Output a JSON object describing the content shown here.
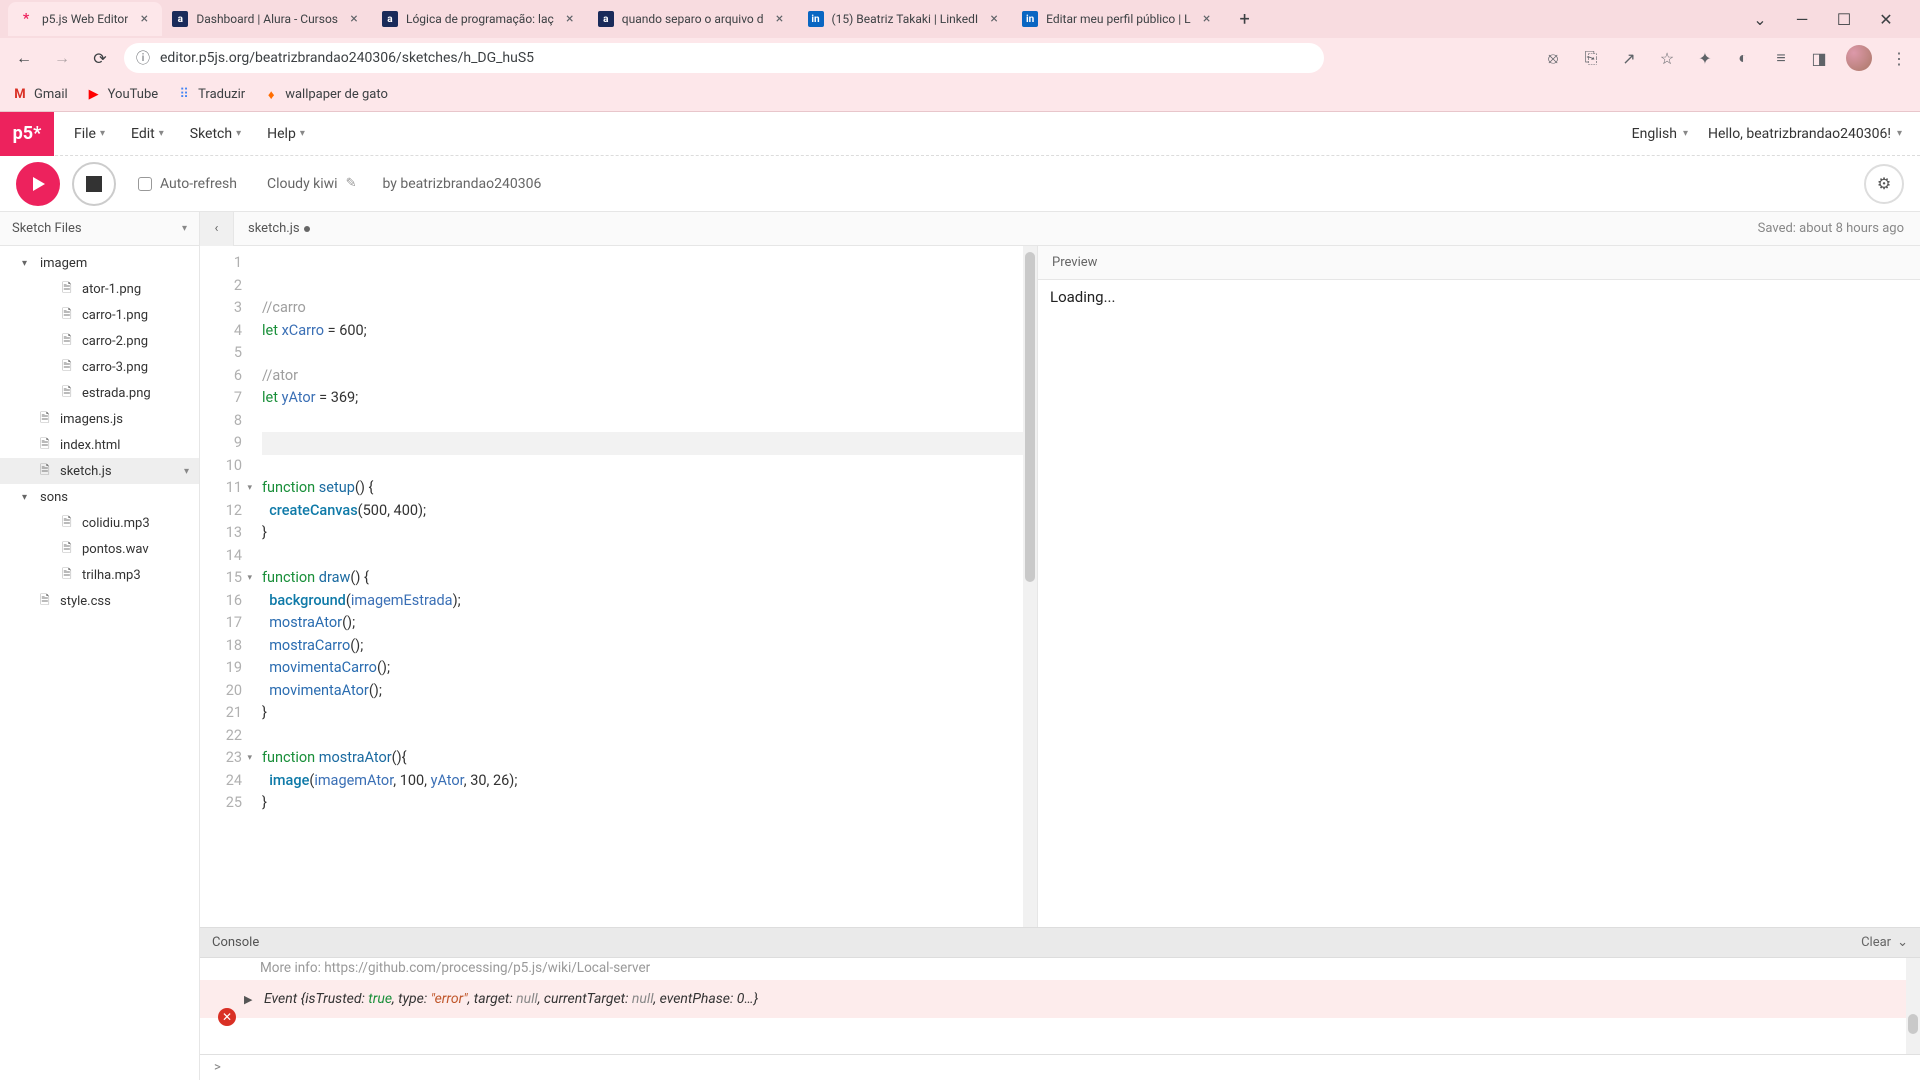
{
  "browser": {
    "tabs": [
      {
        "title": "p5.js Web Editor",
        "favicon": "p5",
        "active": true
      },
      {
        "title": "Dashboard | Alura - Cursos",
        "favicon": "alura"
      },
      {
        "title": "Lógica de programação: laç",
        "favicon": "alura"
      },
      {
        "title": "quando separo o arquivo d",
        "favicon": "alura"
      },
      {
        "title": "(15) Beatriz Takaki | LinkedI",
        "favicon": "linkedin"
      },
      {
        "title": "Editar meu perfil público | L",
        "favicon": "linkedin"
      }
    ],
    "url": "editor.p5js.org/beatrizbrandao240306/sketches/h_DG_huS5",
    "bookmarks": [
      {
        "label": "Gmail",
        "icon": "gmail"
      },
      {
        "label": "YouTube",
        "icon": "youtube"
      },
      {
        "label": "Traduzir",
        "icon": "translate"
      },
      {
        "label": "wallpaper de gato",
        "icon": "fire"
      }
    ]
  },
  "menubar": {
    "logo": "p5*",
    "menus": [
      "File",
      "Edit",
      "Sketch",
      "Help"
    ],
    "language": "English",
    "greeting": "Hello, beatrizbrandao240306!"
  },
  "toolbar": {
    "autorefresh_label": "Auto-refresh",
    "project_name": "Cloudy kiwi",
    "byline_prefix": "by ",
    "byline_user": "beatrizbrandao240306"
  },
  "sidebar": {
    "header": "Sketch Files",
    "tree": [
      {
        "type": "folder",
        "name": "imagem",
        "depth": 1,
        "open": true
      },
      {
        "type": "file",
        "name": "ator-1.png",
        "depth": 2
      },
      {
        "type": "file",
        "name": "carro-1.png",
        "depth": 2
      },
      {
        "type": "file",
        "name": "carro-2.png",
        "depth": 2
      },
      {
        "type": "file",
        "name": "carro-3.png",
        "depth": 2
      },
      {
        "type": "file",
        "name": "estrada.png",
        "depth": 2
      },
      {
        "type": "file",
        "name": "imagens.js",
        "depth": 1
      },
      {
        "type": "file",
        "name": "index.html",
        "depth": 1
      },
      {
        "type": "file",
        "name": "sketch.js",
        "depth": 1,
        "selected": true,
        "opts": true
      },
      {
        "type": "folder",
        "name": "sons",
        "depth": 1,
        "open": true
      },
      {
        "type": "file",
        "name": "colidiu.mp3",
        "depth": 2
      },
      {
        "type": "file",
        "name": "pontos.wav",
        "depth": 2
      },
      {
        "type": "file",
        "name": "trilha.mp3",
        "depth": 2
      },
      {
        "type": "file",
        "name": "style.css",
        "depth": 1
      }
    ]
  },
  "editor": {
    "tab_name": "sketch.js",
    "dirty": true,
    "saved_text": "Saved: about 8 hours ago",
    "line_count": 25,
    "fold_lines": [
      11,
      15,
      23
    ],
    "highlighted_line": 9,
    "lines": [
      {
        "n": 1,
        "html": ""
      },
      {
        "n": 2,
        "html": ""
      },
      {
        "n": 3,
        "html": "<span class='tok-comment'>//carro</span>"
      },
      {
        "n": 4,
        "html": "<span class='tok-kw'>let</span> <span class='tok-var'>xCarro</span> = <span class='tok-num'>600</span>;"
      },
      {
        "n": 5,
        "html": ""
      },
      {
        "n": 6,
        "html": "<span class='tok-comment'>//ator</span>"
      },
      {
        "n": 7,
        "html": "<span class='tok-kw'>let</span> <span class='tok-var'>yAtor</span> = <span class='tok-num'>369</span>;"
      },
      {
        "n": 8,
        "html": ""
      },
      {
        "n": 9,
        "html": ""
      },
      {
        "n": 10,
        "html": ""
      },
      {
        "n": 11,
        "html": "<span class='tok-kw'>function</span> <span class='tok-fn'>setup</span>() {"
      },
      {
        "n": 12,
        "html": "  <span class='tok-builtin'>createCanvas</span>(<span class='tok-num'>500</span>, <span class='tok-num'>400</span>);"
      },
      {
        "n": 13,
        "html": "}"
      },
      {
        "n": 14,
        "html": ""
      },
      {
        "n": 15,
        "html": "<span class='tok-kw'>function</span> <span class='tok-fn'>draw</span>() {"
      },
      {
        "n": 16,
        "html": "  <span class='tok-builtin'>background</span>(<span class='tok-var'>imagemEstrada</span>);"
      },
      {
        "n": 17,
        "html": "  <span class='tok-call'>mostraAtor</span>();"
      },
      {
        "n": 18,
        "html": "  <span class='tok-call'>mostraCarro</span>();"
      },
      {
        "n": 19,
        "html": "  <span class='tok-call'>movimentaCarro</span>();"
      },
      {
        "n": 20,
        "html": "  <span class='tok-call'>movimentaAtor</span>();"
      },
      {
        "n": 21,
        "html": "}"
      },
      {
        "n": 22,
        "html": ""
      },
      {
        "n": 23,
        "html": "<span class='tok-kw'>function</span> <span class='tok-fn'>mostraAtor</span>(){"
      },
      {
        "n": 24,
        "html": "  <span class='tok-builtin'>image</span>(<span class='tok-var'>imagemAtor</span>, <span class='tok-num'>100</span>, <span class='tok-var'>yAtor</span>, <span class='tok-num'>30</span>, <span class='tok-num'>26</span>);"
      },
      {
        "n": 25,
        "html": "}"
      }
    ]
  },
  "preview": {
    "header": "Preview",
    "loading": "Loading..."
  },
  "console": {
    "header": "Console",
    "clear": "Clear",
    "hidden_line": "More info: https://github.com/processing/p5.js/wiki/Local-server",
    "msg_pre": "Event ",
    "msg_open": "{",
    "msg_isTrusted_k": "isTrusted: ",
    "msg_isTrusted_v": "true",
    "msg_type_k": ", type: ",
    "msg_type_v": "\"error\"",
    "msg_target_k": ", target: ",
    "msg_target_v": "null",
    "msg_ct_k": ", currentTarget: ",
    "msg_ct_v": "null",
    "msg_ep_k": ", eventPhase: ",
    "msg_ep_v": "0…",
    "msg_close": "}",
    "prompt": ">"
  }
}
